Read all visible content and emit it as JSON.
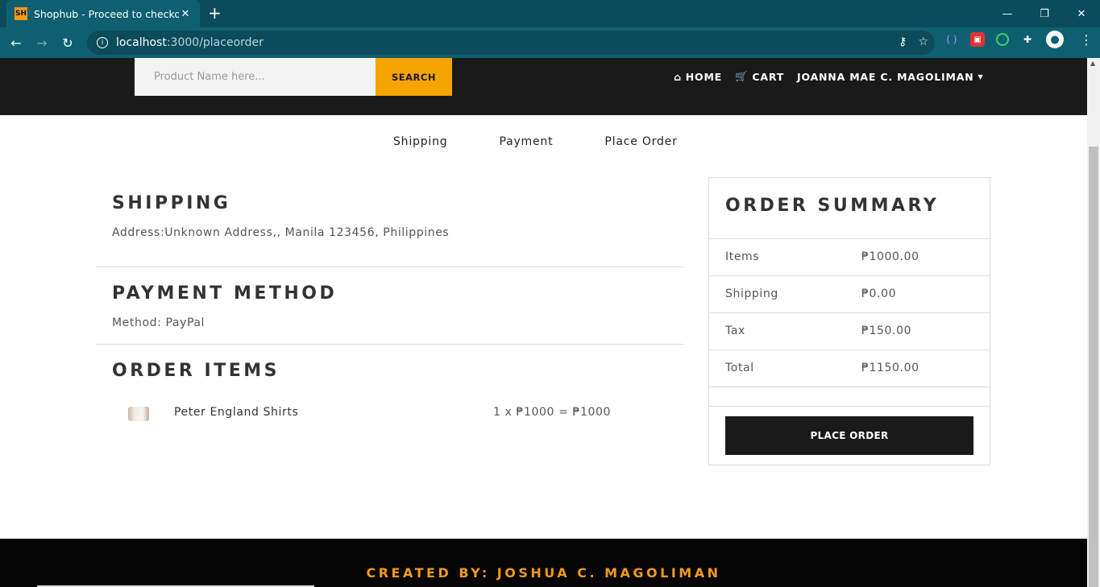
{
  "browser": {
    "tab_title": "Shophub - Proceed to checkout",
    "favicon_text": "SH",
    "url_host": "localhost",
    "url_path": ":3000/placeorder"
  },
  "header": {
    "search_placeholder": "Product Name here...",
    "search_button": "SEARCH",
    "nav": {
      "home": "HOME",
      "cart": "CART",
      "user": "JOANNA MAE C. MAGOLIMAN"
    }
  },
  "steps": [
    "Shipping",
    "Payment",
    "Place Order"
  ],
  "shipping": {
    "title": "SHIPPING",
    "address": "Address:Unknown Address,, Manila 123456, Philippines"
  },
  "payment": {
    "title": "PAYMENT METHOD",
    "method": "Method: PayPal"
  },
  "order_items": {
    "title": "ORDER ITEMS",
    "items": [
      {
        "name": "Peter England Shirts",
        "calc": "1 x ₱1000 = ₱1000"
      }
    ]
  },
  "summary": {
    "title": "ORDER SUMMARY",
    "rows": [
      {
        "label": "Items",
        "value": "₱1000.00"
      },
      {
        "label": "Shipping",
        "value": "₱0.00"
      },
      {
        "label": "Tax",
        "value": "₱150.00"
      },
      {
        "label": "Total",
        "value": "₱1150.00"
      }
    ],
    "button": "PLACE ORDER"
  },
  "footer": {
    "text": "CREATED BY: JOSHUA C. MAGOLIMAN"
  },
  "colors": {
    "accent": "#f6a400",
    "header_bg": "#1a1a1a",
    "chrome_bg": "#0e6070"
  }
}
